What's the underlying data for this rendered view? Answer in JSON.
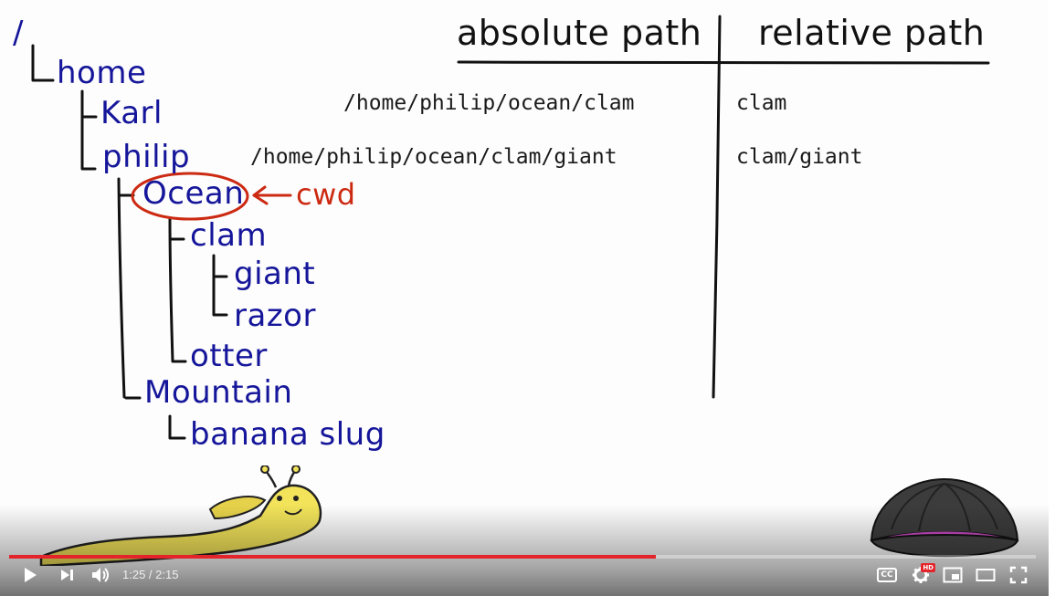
{
  "slide": {
    "headers": {
      "absolute": "absolute path",
      "relative": "relative path"
    },
    "tree": {
      "root": "/",
      "home": "home",
      "karl": "Karl",
      "philip": "philip",
      "ocean": "Ocean",
      "cwd": "cwd",
      "clam": "clam",
      "giant": "giant",
      "razor": "razor",
      "otter": "otter",
      "mountain": "Mountain",
      "banana_slug": "banana slug"
    },
    "rows": [
      {
        "absolute": "/home/philip/ocean/clam",
        "relative": "clam"
      },
      {
        "absolute": "/home/philip/ocean/clam/giant",
        "relative": "clam/giant"
      }
    ]
  },
  "player": {
    "current_time": "1:25",
    "separator": " / ",
    "duration": "2:15",
    "progress_fraction": 0.63,
    "cc_label": "CC",
    "hd_label": "HD",
    "accent_color": "#e3242b",
    "icons": {
      "play": "play-icon",
      "next": "next-icon",
      "volume": "volume-icon",
      "captions": "captions-icon",
      "settings": "settings-gear-icon",
      "miniplayer": "miniplayer-icon",
      "theater": "theater-mode-icon",
      "fullscreen": "fullscreen-icon"
    }
  }
}
